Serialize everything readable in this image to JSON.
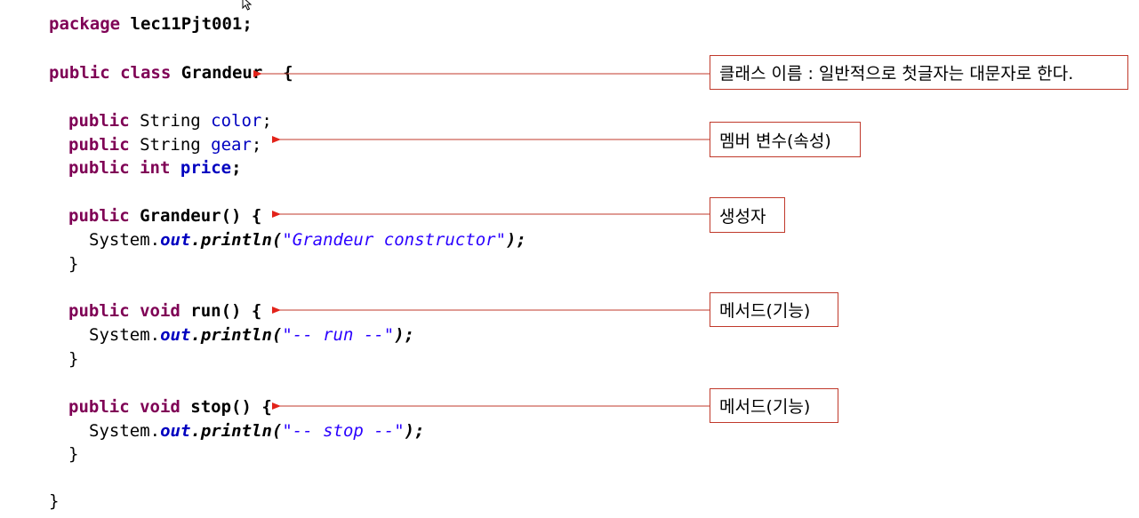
{
  "code": {
    "package_kw": "package",
    "package_name": " lec11Pjt001;",
    "class_kw_public": "public",
    "class_kw_class": "class",
    "class_name": "Grandeur",
    "class_open": "{",
    "field_color": {
      "mod": "public",
      "type": " String ",
      "name": "color",
      "semi": ";"
    },
    "field_gear": {
      "mod": "public",
      "type": " String ",
      "name": "gear",
      "semi": ";"
    },
    "field_price": {
      "mod": "public",
      "type": "int",
      "name": "price",
      "semi": ";"
    },
    "ctor": {
      "mod": "public",
      "sig": " Grandeur() {"
    },
    "ctor_body": {
      "sys": "System.",
      "out": "out",
      "println": ".println(",
      "str": "\"Grandeur constructor\"",
      "end": ");"
    },
    "close_brace": "}",
    "run": {
      "mod": "public",
      "void": "void",
      "sig": " run() {"
    },
    "run_body": {
      "sys": "System.",
      "out": "out",
      "println": ".println(",
      "str": "\"-- run --\"",
      "end": ");"
    },
    "stop": {
      "mod": "public",
      "void": "void",
      "sig": " stop() {"
    },
    "stop_body": {
      "sys": "System.",
      "out": "out",
      "println": ".println(",
      "str": "\"-- stop --\"",
      "end": ");"
    },
    "class_close": "}"
  },
  "callouts": {
    "class_name": "클래스 이름 : 일반적으로 첫글자는 대문자로 한다.",
    "member_vars": "멤버 변수(속성)",
    "constructor": "생성자",
    "method_run": "메서드(기능)",
    "method_stop": "메서드(기능)"
  },
  "colors": {
    "keyword": "#7f0055",
    "field": "#0000c0",
    "string": "#2a00ff",
    "arrow": "#c0392b"
  },
  "icons": {
    "cursor": "mouse-pointer-icon"
  }
}
